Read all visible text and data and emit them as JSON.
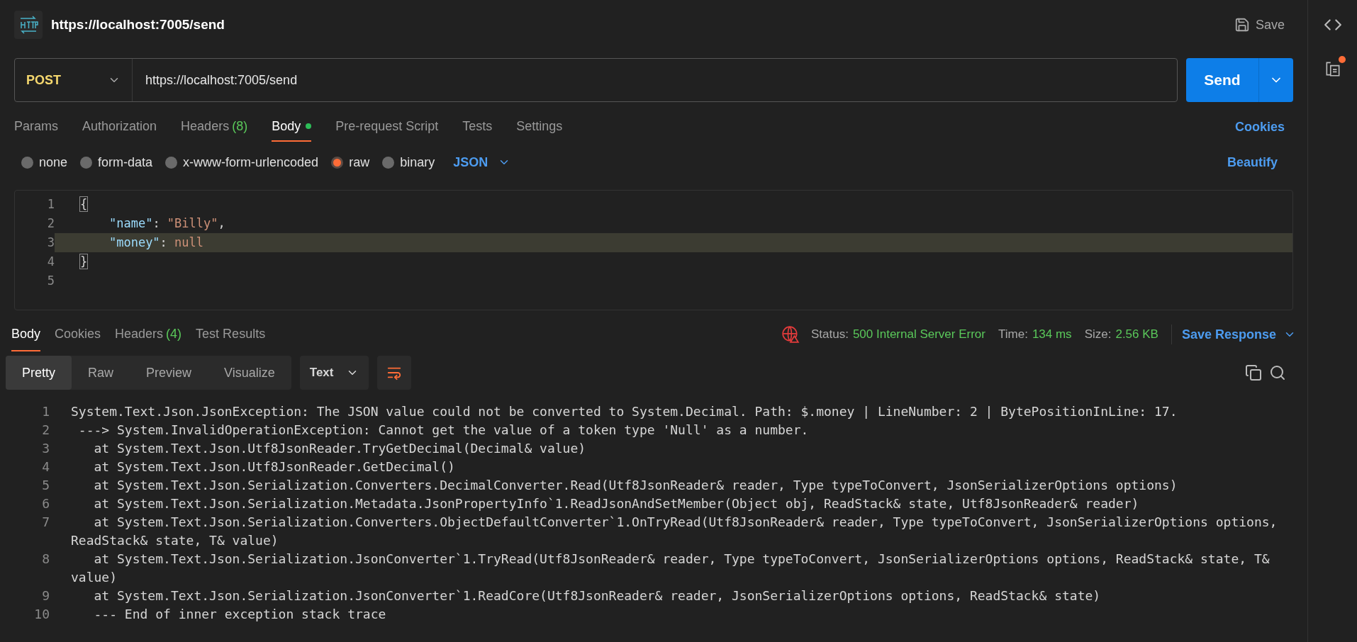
{
  "request": {
    "title": "https://localhost:7005/send",
    "save": "Save",
    "method": "POST",
    "url": "https://localhost:7005/send",
    "send": "Send"
  },
  "request_tabs": [
    {
      "label": "Params",
      "selected": false
    },
    {
      "label": "Authorization",
      "selected": false
    },
    {
      "label": "Headers",
      "count": "(8)",
      "selected": false
    },
    {
      "label": "Body",
      "dot": true,
      "selected": true
    },
    {
      "label": "Pre-request Script",
      "selected": false
    },
    {
      "label": "Tests",
      "selected": false
    },
    {
      "label": "Settings",
      "selected": false
    }
  ],
  "cookies": "Cookies",
  "body_types": [
    {
      "label": "none",
      "selected": false
    },
    {
      "label": "form-data",
      "selected": false
    },
    {
      "label": "x-www-form-urlencoded",
      "selected": false
    },
    {
      "label": "raw",
      "selected": true
    },
    {
      "label": "binary",
      "selected": false
    }
  ],
  "format": "JSON",
  "beautify": "Beautify",
  "editor_lines": [
    {
      "number": "1",
      "current": false,
      "tokens": [
        {
          "kind": "bracket",
          "text": "{"
        }
      ]
    },
    {
      "number": "2",
      "current": false,
      "tokens": [
        {
          "kind": "key",
          "text": "\"name\""
        },
        {
          "kind": "punct",
          "text": ": "
        },
        {
          "kind": "string",
          "text": "\"Billy\""
        },
        {
          "kind": "punct",
          "text": ","
        }
      ]
    },
    {
      "number": "3",
      "current": true,
      "tokens": [
        {
          "kind": "key",
          "text": "\"money\""
        },
        {
          "kind": "punct",
          "text": ": "
        },
        {
          "kind": "string",
          "text": "null"
        }
      ]
    },
    {
      "number": "4",
      "current": false,
      "tokens": [
        {
          "kind": "bracket",
          "text": "}"
        }
      ]
    },
    {
      "number": "5",
      "current": false
    }
  ],
  "response_tabs": [
    {
      "label": "Body",
      "selected": true
    },
    {
      "label": "Cookies",
      "selected": false
    },
    {
      "label": "Headers",
      "count": "(4)",
      "selected": false
    },
    {
      "label": "Test Results",
      "selected": false
    }
  ],
  "status": {
    "items": [
      {
        "label": "Status:",
        "value": "500 Internal Server Error"
      },
      {
        "label": "Time:",
        "value": "134 ms"
      },
      {
        "label": "Size:",
        "value": "2.56 KB"
      }
    ],
    "save_response": "Save Response"
  },
  "view_tabs": [
    {
      "label": "Pretty",
      "selected": true
    },
    {
      "label": "Raw",
      "selected": false
    },
    {
      "label": "Preview",
      "selected": false
    },
    {
      "label": "Visualize",
      "selected": false
    }
  ],
  "view_format": "Text",
  "response_lines": [
    {
      "number": "1",
      "text": "System.Text.Json.JsonException: The JSON value could not be converted to System.Decimal. Path: $.money | LineNumber: 2 | BytePositionInLine: 17."
    },
    {
      "number": "2",
      "text": " ---> System.InvalidOperationException: Cannot get the value of a token type 'Null' as a number."
    },
    {
      "number": "3",
      "text": "   at System.Text.Json.Utf8JsonReader.TryGetDecimal(Decimal& value)"
    },
    {
      "number": "4",
      "text": "   at System.Text.Json.Utf8JsonReader.GetDecimal()"
    },
    {
      "number": "5",
      "text": "   at System.Text.Json.Serialization.Converters.DecimalConverter.Read(Utf8JsonReader& reader, Type typeToConvert, JsonSerializerOptions options)"
    },
    {
      "number": "6",
      "text": "   at System.Text.Json.Serialization.Metadata.JsonPropertyInfo`1.ReadJsonAndSetMember(Object obj, ReadStack& state, Utf8JsonReader& reader)"
    },
    {
      "number": "7",
      "text": "   at System.Text.Json.Serialization.Converters.ObjectDefaultConverter`1.OnTryRead(Utf8JsonReader& reader, Type typeToConvert, JsonSerializerOptions options, ReadStack& state, T& value)"
    },
    {
      "number": "8",
      "text": "   at System.Text.Json.Serialization.JsonConverter`1.TryRead(Utf8JsonReader& reader, Type typeToConvert, JsonSerializerOptions options, ReadStack& state, T& value)"
    },
    {
      "number": "9",
      "text": "   at System.Text.Json.Serialization.JsonConverter`1.ReadCore(Utf8JsonReader& reader, JsonSerializerOptions options, ReadStack& state)"
    },
    {
      "number": "10",
      "text": "   --- End of inner exception stack trace"
    }
  ]
}
